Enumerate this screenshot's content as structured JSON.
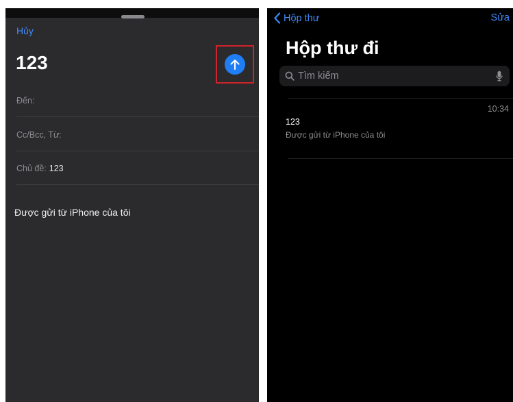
{
  "compose": {
    "cancel_label": "Hủy",
    "subject_title": "123",
    "to_label": "Đến:",
    "cc_bcc_from_label": "Cc/Bcc, Từ:",
    "subject_label": "Chủ đề:",
    "subject_value": "123",
    "body": "Được gửi từ iPhone của tôi",
    "send_icon": "arrow-up-icon"
  },
  "outbox": {
    "back_label": "Hộp thư",
    "edit_label": "Sửa",
    "title": "Hộp thư đi",
    "search": {
      "placeholder": "Tìm kiếm"
    },
    "messages": [
      {
        "time": "10:34",
        "subject": "123",
        "preview": "Được gửi từ iPhone của tôi"
      }
    ]
  },
  "colors": {
    "accent": "#3d8bfd",
    "send_button": "#1f7ef5",
    "highlight_box": "#d0232a",
    "compose_bg": "#2b2b2d",
    "outbox_bg": "#000000"
  }
}
